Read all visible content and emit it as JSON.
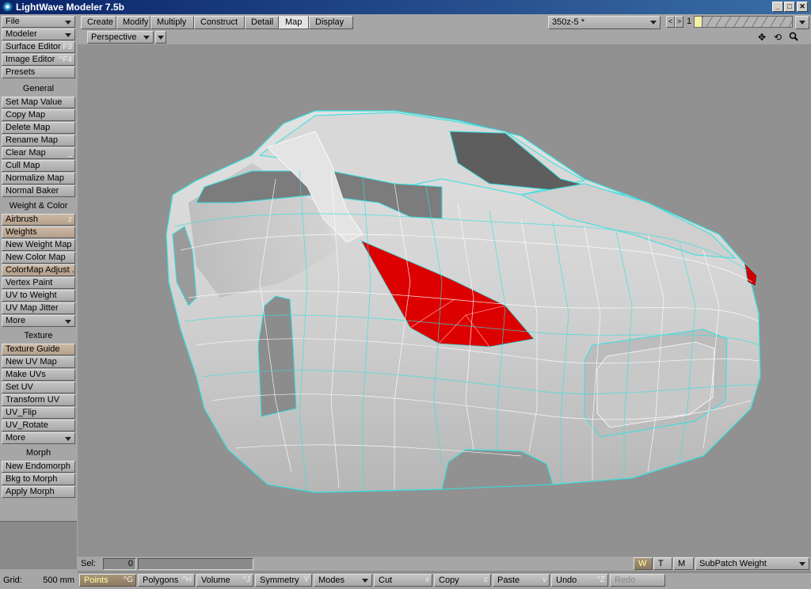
{
  "window": {
    "title": "LightWave Modeler 7.5b",
    "controls": [
      "_",
      "□",
      "✕"
    ]
  },
  "tabs": [
    {
      "label": "Create",
      "active": false
    },
    {
      "label": "Modify",
      "active": false
    },
    {
      "label": "Multiply",
      "active": false
    },
    {
      "label": "Construct",
      "active": false
    },
    {
      "label": "Detail",
      "active": false
    },
    {
      "label": "Map",
      "active": true
    },
    {
      "label": "Display",
      "active": false
    }
  ],
  "layer_select": {
    "value": "350z-5 *",
    "prev": "<",
    "next": ">",
    "layer_num": "1"
  },
  "viewport": {
    "mode": "Perspective",
    "icons": [
      "move-icon",
      "rotate-icon",
      "zoom-icon"
    ],
    "icon_glyphs": [
      "✥",
      "⟲",
      "🔍"
    ]
  },
  "sidebar": {
    "top": [
      {
        "label": "File",
        "dropdown": true
      },
      {
        "label": "Modeler",
        "dropdown": true
      },
      {
        "label": "Surface Editor",
        "shortcut": "F3"
      },
      {
        "label": "Image Editor",
        "shortcut": "^F4"
      },
      {
        "label": "Presets"
      }
    ],
    "general_header": "General",
    "general": [
      {
        "label": "Set Map Value"
      },
      {
        "label": "Copy Map"
      },
      {
        "label": "Delete Map"
      },
      {
        "label": "Rename Map"
      },
      {
        "label": "Clear Map",
        "shortcut": "_"
      },
      {
        "label": "Cull Map"
      },
      {
        "label": "Normalize Map"
      },
      {
        "label": "Normal Baker"
      }
    ],
    "weight_header": "Weight & Color",
    "weight": [
      {
        "label": "Airbrush",
        "shortcut": "z",
        "highlight": true
      },
      {
        "label": "Weights",
        "highlight": true
      },
      {
        "label": "New Weight Map"
      },
      {
        "label": "New Color Map"
      },
      {
        "label": "ColorMap Adjust ...",
        "highlight": true
      },
      {
        "label": "Vertex Paint"
      },
      {
        "label": "UV to Weight"
      },
      {
        "label": "UV Map Jitter"
      },
      {
        "label": "More",
        "dropdown": true
      }
    ],
    "texture_header": "Texture",
    "texture": [
      {
        "label": "Texture Guide",
        "highlight": true
      },
      {
        "label": "New UV Map"
      },
      {
        "label": "Make UVs"
      },
      {
        "label": "Set UV"
      },
      {
        "label": "Transform UV"
      },
      {
        "label": "UV_Flip"
      },
      {
        "label": "UV_Rotate"
      },
      {
        "label": "More",
        "dropdown": true
      }
    ],
    "morph_header": "Morph",
    "morph": [
      {
        "label": "New Endomorph"
      },
      {
        "label": "Bkg to Morph"
      },
      {
        "label": "Apply Morph"
      }
    ]
  },
  "status": {
    "sel_label": "Sel:",
    "sel_value": "0",
    "wtm": [
      "W",
      "T",
      "M"
    ],
    "vmap_select": "SubPatch Weight"
  },
  "bottom": {
    "grid_label": "Grid:",
    "grid_value": "500 mm",
    "buttons": [
      {
        "label": "Points",
        "shortcut": "^G",
        "active": true
      },
      {
        "label": "Polygons",
        "shortcut": "^H"
      },
      {
        "label": "Volume",
        "shortcut": "^J"
      },
      {
        "label": "Symmetry",
        "shortcut": "Y"
      },
      {
        "label": "Modes",
        "dropdown": true
      },
      {
        "label": "Cut",
        "shortcut": "x"
      },
      {
        "label": "Copy",
        "shortcut": "c"
      },
      {
        "label": "Paste",
        "shortcut": "v"
      },
      {
        "label": "Undo",
        "shortcut": "^Z"
      },
      {
        "label": "Redo",
        "dim": true
      }
    ]
  },
  "colors": {
    "viewport_bg": "#919191",
    "wire": "#33e0e0",
    "selection": "#dd0000",
    "panel": "#a6a6a6"
  }
}
